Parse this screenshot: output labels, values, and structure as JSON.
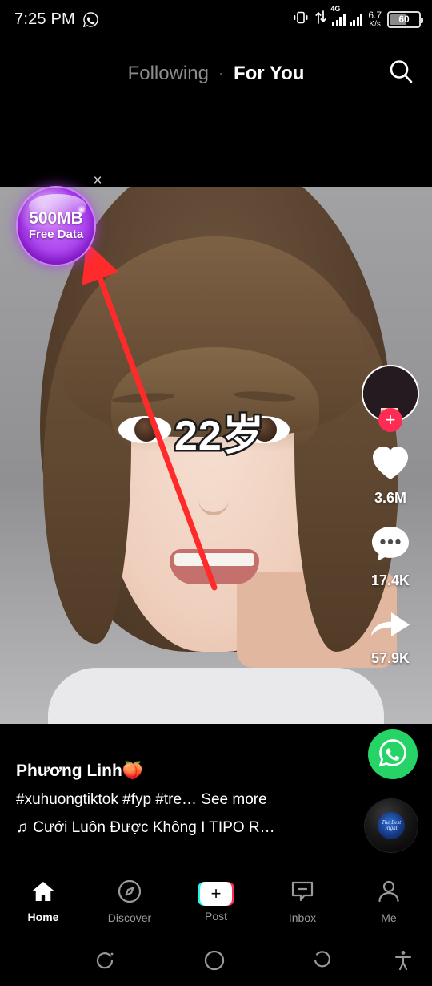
{
  "statusbar": {
    "time": "7:25 PM",
    "notification_icon": "whatsapp-icon",
    "vibrate_icon": "vibrate-icon",
    "data_transfer_icon": "data-transfer-icon",
    "network_type": "4G",
    "net_speed_value": "6.7",
    "net_speed_unit": "K/s",
    "battery_percent": "60"
  },
  "topbar": {
    "tab_following": "Following",
    "tab_foryou": "For You",
    "search_icon": "search-icon"
  },
  "ad": {
    "line1": "500MB",
    "line2": "Free Data",
    "close_label": "×"
  },
  "video": {
    "overlay_text": "22岁",
    "annotation": "red-arrow"
  },
  "rail": {
    "follow_label": "+",
    "like_icon": "heart-icon",
    "like_count": "3.6M",
    "comment_icon": "comment-icon",
    "comment_count": "17.4K",
    "share_icon": "share-arrow-icon",
    "share_count": "57.9K",
    "whatsapp_icon": "whatsapp-share-icon",
    "music_disc_label": "The Best Right"
  },
  "caption": {
    "username": "Phương Linh🍑",
    "hashtags": "#xuhuongtiktok #fyp #tre…",
    "see_more": "See more",
    "music_note": "♫",
    "music_title": "Cưới Luôn Được Không I TIPO R…"
  },
  "bottomnav": {
    "items": [
      {
        "label": "Home",
        "icon": "home-icon",
        "active": true
      },
      {
        "label": "Discover",
        "icon": "compass-icon",
        "active": false
      },
      {
        "label": "Post",
        "icon": "plus-icon",
        "active": false
      },
      {
        "label": "Inbox",
        "icon": "inbox-icon",
        "active": false
      },
      {
        "label": "Me",
        "icon": "person-icon",
        "active": false
      }
    ]
  },
  "androidnav": {
    "recents_icon": "recents-icon",
    "home_icon": "home-circle-icon",
    "back_icon": "back-icon",
    "accessibility_icon": "accessibility-icon"
  },
  "colors": {
    "accent_pink": "#fe2c55",
    "accent_cyan": "#25f4ee",
    "whatsapp_green": "#25d366",
    "ad_purple": "#9b23e8",
    "annotation_red": "#ff2b2b"
  }
}
